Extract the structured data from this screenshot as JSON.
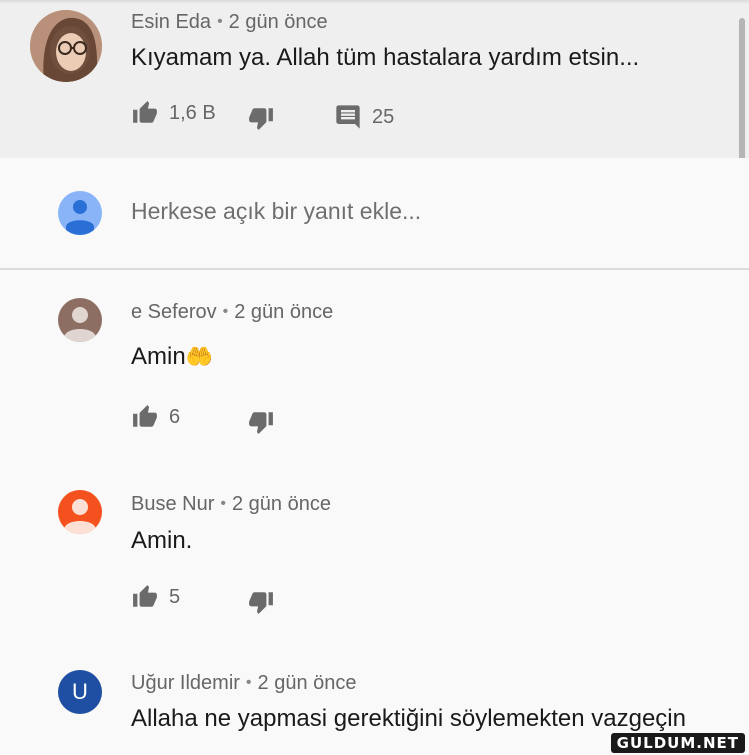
{
  "comments": [
    {
      "author": "Esin Eda",
      "time": "2 gün önce",
      "text": "Kıyamam ya. Allah tüm hastalara yardım etsin...",
      "likes": "1,6 B",
      "replies": "25"
    },
    {
      "author": "e Seferov",
      "time": "2 gün önce",
      "text": "Amin",
      "emoji": "🤲",
      "likes": "6"
    },
    {
      "author": "Buse Nur",
      "time": "2 gün önce",
      "text": "Amin.",
      "likes": "5"
    },
    {
      "author": "Uğur Ildemir",
      "time": "2 gün önce",
      "text": "Allaha ne yapmasi gerektiğini söylemekten vazgeçin",
      "avatar_letter": "U"
    }
  ],
  "reply_box": {
    "placeholder": "Herkese açık bir yanıt ekle..."
  },
  "separator": "•",
  "watermark": "GULDUM.NET",
  "colors": {
    "avatar_user": "#8ab4f8",
    "avatar_seferov": "#8d6e63",
    "avatar_buse": "#f4511e",
    "avatar_ugur": "#1e4fa3",
    "icon_gray": "#6b6b6b",
    "highlight_bg": "#efefef"
  },
  "icons": [
    "like-icon",
    "dislike-icon",
    "reply-comment-icon",
    "default-user-icon"
  ]
}
